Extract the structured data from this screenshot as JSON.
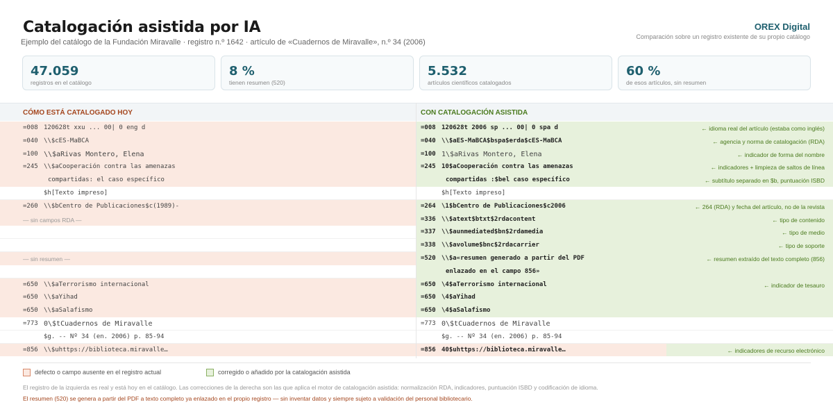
{
  "header": {
    "title": "Catalogación asistida por IA",
    "subtitle": "Ejemplo del catálogo de la Fundación Miravalle · registro n.º 1642 · artículo de «Cuadernos de Miravalle», n.º 34 (2006)",
    "brand": "OREX Digital",
    "brand_sub": "Comparación sobre un registro existente de su propio catálogo"
  },
  "stats": [
    {
      "value": "47.059",
      "label": "registros en el catálogo"
    },
    {
      "value": "8 %",
      "label": "tienen resumen (520)"
    },
    {
      "value": "5.532",
      "label": "artículos científicos catalogados"
    },
    {
      "value": "60 %",
      "label": "de esos artículos, sin resumen"
    }
  ],
  "columns": {
    "left": "CÓMO ESTÁ CATALOGADO HOY",
    "right": "CON CATALOGACIÓN ASISTIDA"
  },
  "rows": [
    {
      "left_tag": "=008",
      "left_text": "120628t xxu ... 00| 0 eng d",
      "right_tag": "=008",
      "right_text": "120628t 2006 sp ... 00| 0 spa d",
      "note": "← idioma real del artículo (estaba como inglés)"
    },
    {
      "left_tag": "=040",
      "left_text": "\\\\$cES-MaBCA",
      "right_tag": "=040",
      "right_text": "\\\\$aES-MaBCA$bspa$erda$cES-MaBCA",
      "note": "← agencia y norma de catalogación (RDA)"
    },
    {
      "left_tag": "=100",
      "left_text": "\\\\$aRivas Montero, Elena",
      "right_tag": "=100",
      "right_text": "1\\$aRivas Montero, Elena",
      "note": "← indicador de forma del nombre"
    },
    {
      "left_tag": "=245",
      "left_text": "\\\\$aCooperación contra las amenazas",
      "right_tag": "=245",
      "right_text": "10$aCooperación contra las amenazas",
      "note": "← indicadores + limpieza de saltos de línea"
    },
    {
      "left_tag": "",
      "left_text": "compartidas: el caso específico  ",
      "right_tag": "",
      "right_text": "compartidas :$bel caso específico",
      "note": "← subtítulo separado en $b, puntuación ISBD"
    },
    {
      "left_tag": "",
      "left_text": "$h[Texto impreso]",
      "right_tag": "",
      "right_text": "$h[Texto impreso]",
      "note": ""
    },
    {
      "left_tag": "=260",
      "left_text": "\\\\$bCentro de Publicaciones$c(1989)-",
      "right_tag": "=264",
      "right_text": "\\1$bCentro de Publicaciones$c2006",
      "note": "← 264 (RDA) y fecha del artículo, no de la revista"
    },
    {
      "left_placeholder": "— sin campos RDA —",
      "right_tag": "=336",
      "right_text": "\\\\$atext$btxt$2rdacontent",
      "note": "← tipo de contenido"
    },
    {
      "left_placeholder": "",
      "right_tag": "=337",
      "right_text": "\\\\$aunmediated$bn$2rdamedia",
      "note": "← tipo de medio"
    },
    {
      "left_placeholder": "",
      "right_tag": "=338",
      "right_text": "\\\\$avolume$bnc$2rdacarrier",
      "note": "← tipo de soporte"
    },
    {
      "left_placeholder": "— sin resumen —",
      "right_tag": "=520",
      "right_text": "\\\\$a«resumen generado a partir del PDF",
      "note": "← resumen extraído del texto completo (856)"
    },
    {
      "left_placeholder": "",
      "right_tag": "",
      "right_text": "enlazado en el campo 856»",
      "note": ""
    },
    {
      "left_tag": "=650",
      "left_text": "\\\\$aTerrorismo internacional",
      "right_tag": "=650",
      "right_text": "\\4$aTerrorismo internacional",
      "note": "← indicador de tesauro"
    },
    {
      "left_tag": "=650",
      "left_text": "\\\\$aYihad",
      "right_tag": "=650",
      "right_text": "\\4$aYihad",
      "note": ""
    },
    {
      "left_tag": "=650",
      "left_text": "\\\\$aSalafismo",
      "right_tag": "=650",
      "right_text": "\\4$aSalafismo",
      "note": ""
    },
    {
      "left_tag": "=773",
      "left_text": "0\\$tCuadernos de Miravalle",
      "right_tag": "=773",
      "right_text": "0\\$tCuadernos de Miravalle",
      "note": ""
    },
    {
      "left_tag": "",
      "left_text": "$g. -- Nº 34 (en. 2006) p. 85-94",
      "right_tag": "",
      "right_text": "$g. -- Nº 34 (en. 2006) p. 85-94",
      "note": ""
    },
    {
      "left_tag": "=856",
      "left_text": "\\\\$uhttps://biblioteca.miravalle…",
      "right_tag": "=856",
      "right_text": "40$uhttps://biblioteca.miravalle…",
      "note": "← indicadores de recurso electrónico"
    }
  ],
  "legend": {
    "bad": "defecto o campo ausente en el registro actual",
    "good": "corregido o añadido por la catalogación asistida"
  },
  "footer": {
    "line1": "El registro de la izquierda es real y está hoy en el catálogo. Las correcciones de la derecha son las que aplica el motor de catalogación asistida: normalización RDA, indicadores, puntuación ISBD y codificación de idioma.",
    "line2": "El resumen (520) se genera a partir del PDF a texto completo ya enlazado en el propio registro — sin inventar datos y siempre sujeto a validación del personal bibliotecario."
  },
  "colors": {
    "accent": "#1e5f6e",
    "bad_bg": "#fbe9e1",
    "good_bg": "#e7f1dc",
    "bad_text": "#a4461e",
    "good_text": "#4a7a1e"
  }
}
